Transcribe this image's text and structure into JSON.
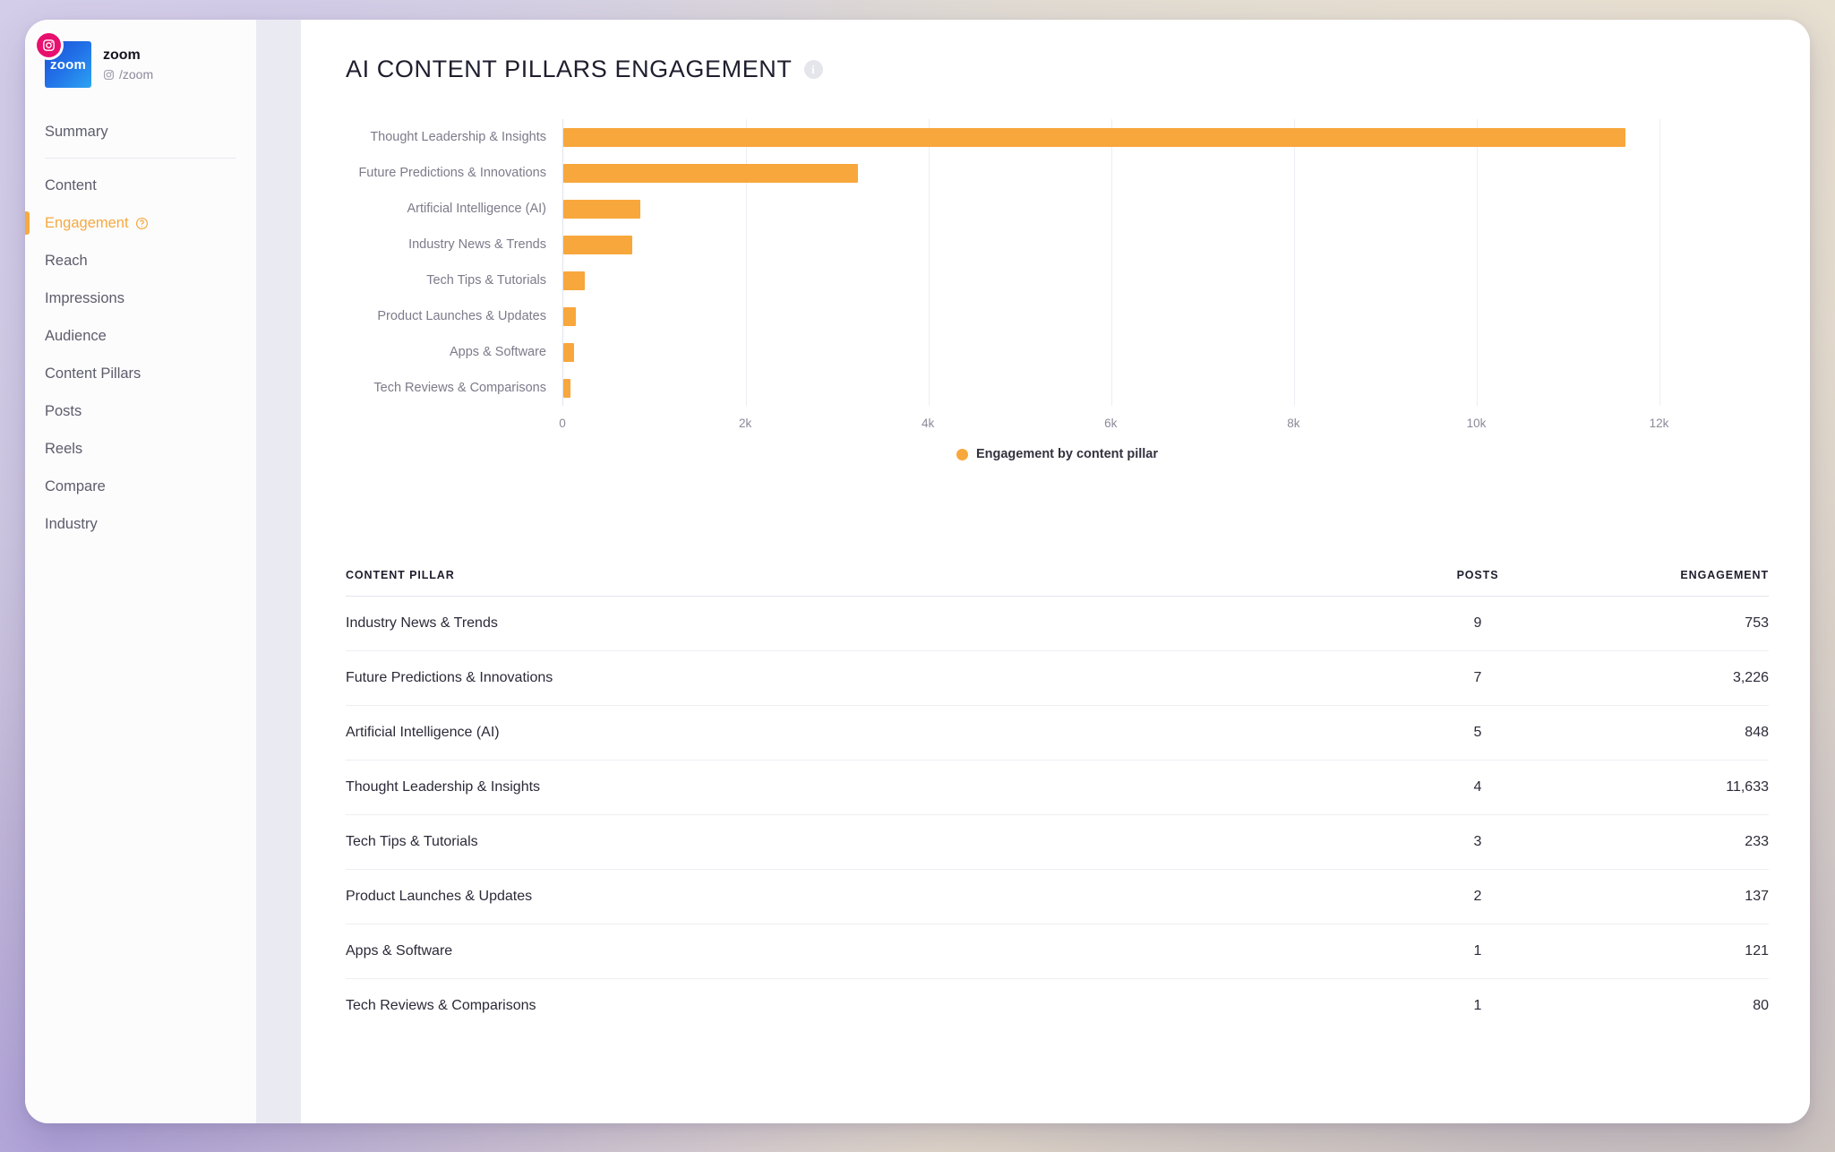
{
  "profile": {
    "name": "zoom",
    "handle": "/zoom",
    "avatar_text": "zoom",
    "platform_icon": "instagram-icon"
  },
  "sidebar": {
    "items": [
      {
        "label": "Summary",
        "active": false,
        "help": false
      },
      {
        "label": "Content",
        "active": false,
        "help": false
      },
      {
        "label": "Engagement",
        "active": true,
        "help": true
      },
      {
        "label": "Reach",
        "active": false,
        "help": false
      },
      {
        "label": "Impressions",
        "active": false,
        "help": false
      },
      {
        "label": "Audience",
        "active": false,
        "help": false
      },
      {
        "label": "Content Pillars",
        "active": false,
        "help": false
      },
      {
        "label": "Posts",
        "active": false,
        "help": false
      },
      {
        "label": "Reels",
        "active": false,
        "help": false
      },
      {
        "label": "Compare",
        "active": false,
        "help": false
      },
      {
        "label": "Industry",
        "active": false,
        "help": false
      }
    ]
  },
  "main": {
    "title": "AI CONTENT PILLARS ENGAGEMENT",
    "info_icon_glyph": "i"
  },
  "chart_data": {
    "type": "bar",
    "orientation": "horizontal",
    "title": "AI CONTENT PILLARS ENGAGEMENT",
    "xlabel": "",
    "ylabel": "",
    "xlim": [
      0,
      13200
    ],
    "categories": [
      "Thought Leadership & Insights",
      "Future Predictions & Innovations",
      "Artificial Intelligence (AI)",
      "Industry News & Trends",
      "Tech Tips & Tutorials",
      "Product Launches & Updates",
      "Apps & Software",
      "Tech Reviews & Comparisons"
    ],
    "values": [
      11633,
      3226,
      848,
      753,
      233,
      137,
      121,
      80
    ],
    "xticks": [
      0,
      2000,
      4000,
      6000,
      8000,
      10000,
      12000
    ],
    "xticklabels": [
      "0",
      "2k",
      "4k",
      "6k",
      "8k",
      "10k",
      "12k"
    ],
    "grid": true,
    "legend": [
      {
        "label": "Engagement by content pillar",
        "color": "#f8a73c"
      }
    ],
    "legend_position": "bottom",
    "bar_color": "#f8a73c"
  },
  "table": {
    "columns": [
      "CONTENT PILLAR",
      "POSTS",
      "ENGAGEMENT"
    ],
    "rows": [
      {
        "pillar": "Industry News & Trends",
        "posts": "9",
        "engagement": "753"
      },
      {
        "pillar": "Future Predictions & Innovations",
        "posts": "7",
        "engagement": "3,226"
      },
      {
        "pillar": "Artificial Intelligence (AI)",
        "posts": "5",
        "engagement": "848"
      },
      {
        "pillar": "Thought Leadership & Insights",
        "posts": "4",
        "engagement": "11,633"
      },
      {
        "pillar": "Tech Tips & Tutorials",
        "posts": "3",
        "engagement": "233"
      },
      {
        "pillar": "Product Launches & Updates",
        "posts": "2",
        "engagement": "137"
      },
      {
        "pillar": "Apps & Software",
        "posts": "1",
        "engagement": "121"
      },
      {
        "pillar": "Tech Reviews & Comparisons",
        "posts": "1",
        "engagement": "80"
      }
    ]
  },
  "colors": {
    "accent": "#f5a93f",
    "bar": "#f8a73c",
    "badge": "#e8106e",
    "gap": "#eaebf2"
  }
}
